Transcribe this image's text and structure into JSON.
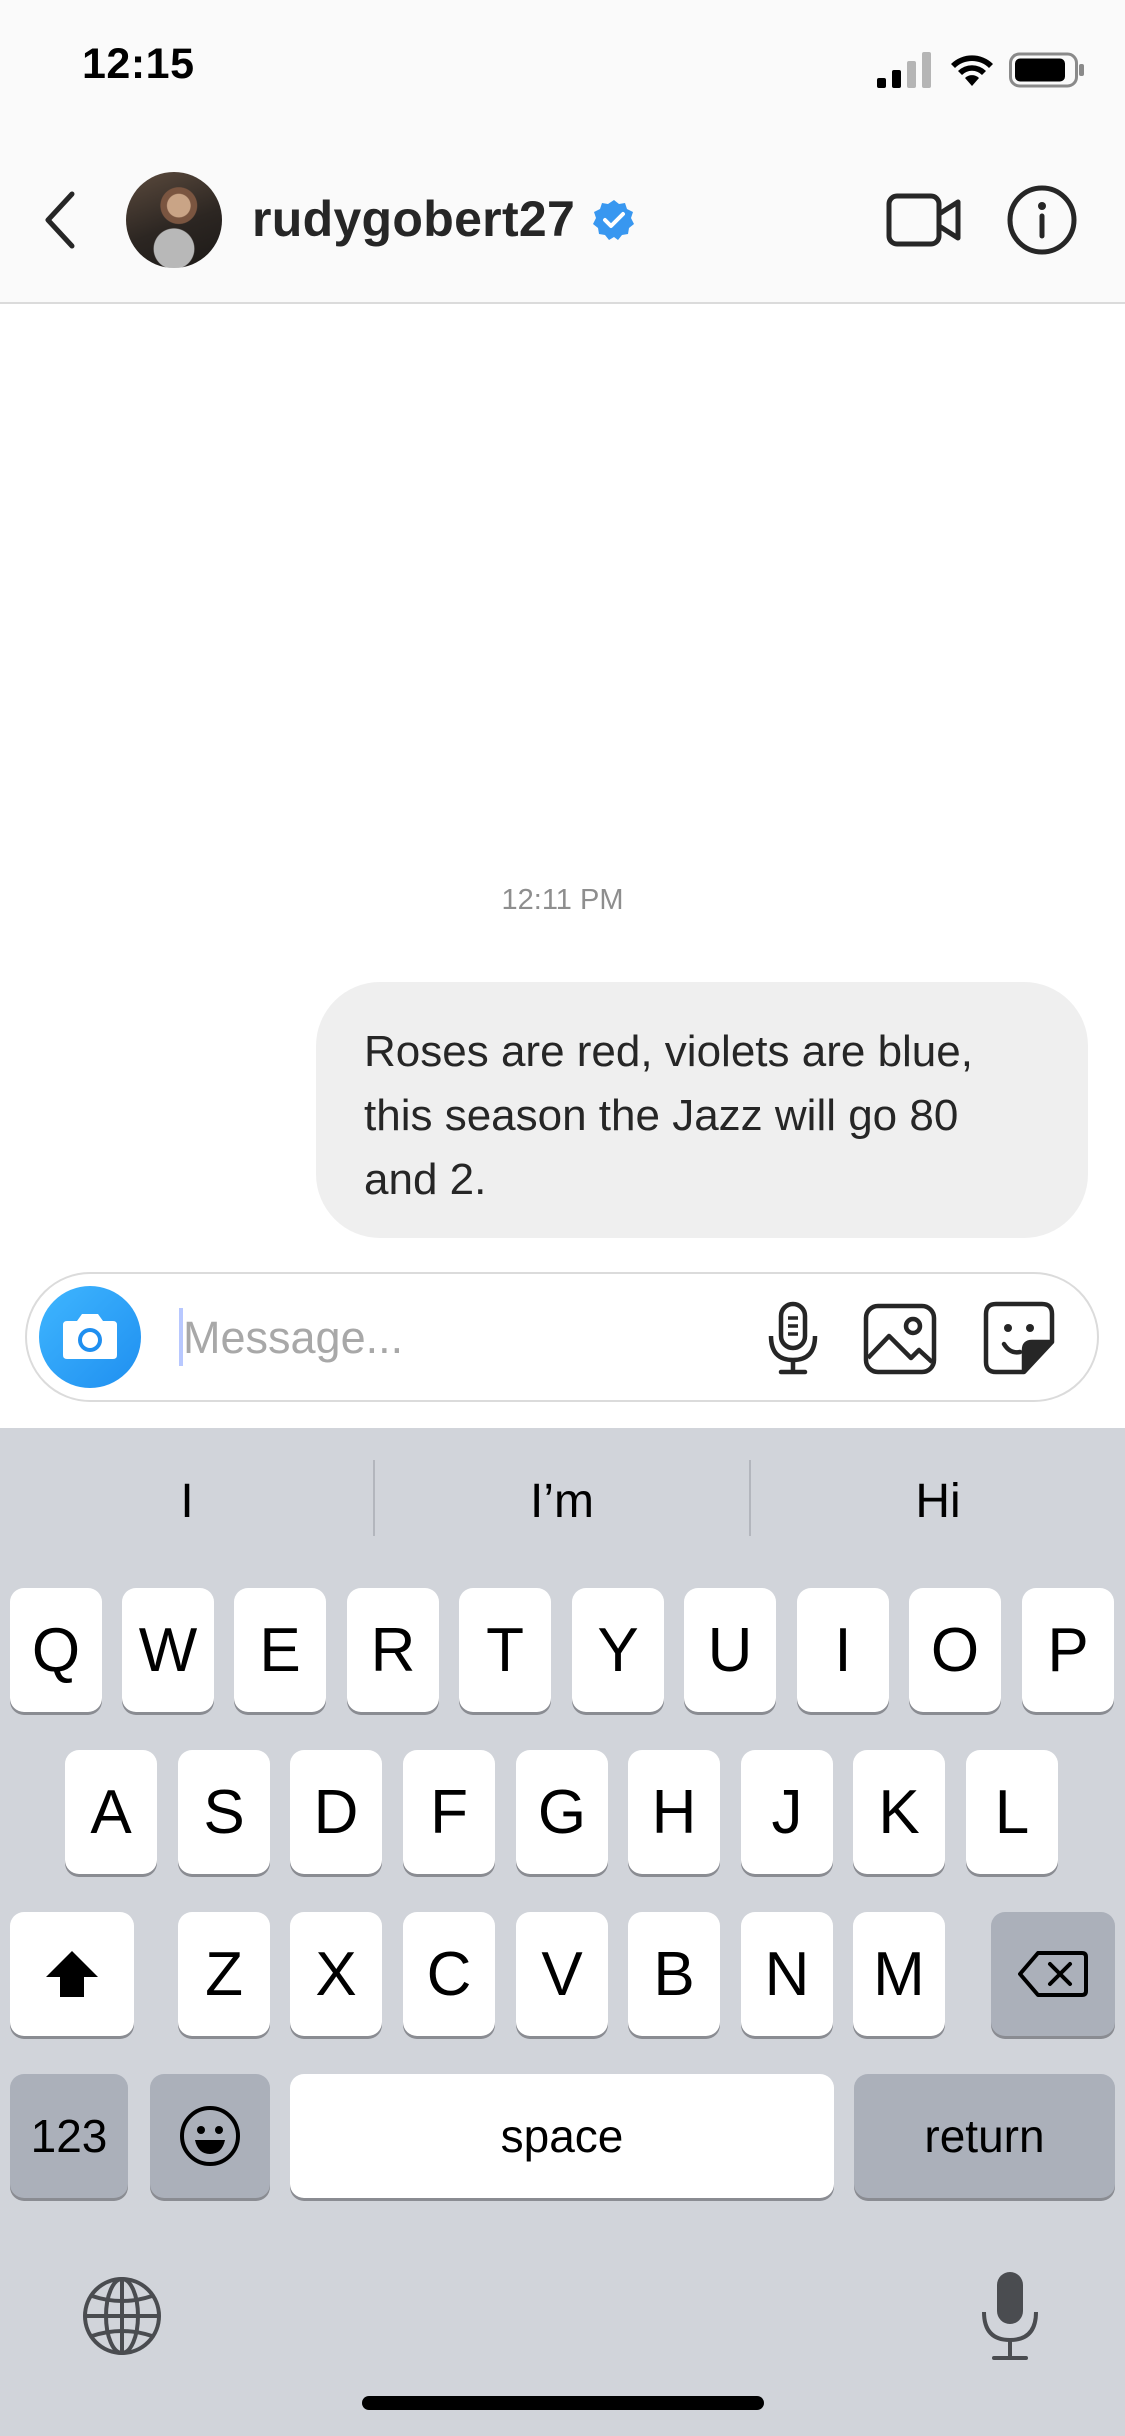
{
  "status_bar": {
    "time": "12:15",
    "icons": [
      "cellular-signal-icon",
      "wifi-icon",
      "battery-icon"
    ]
  },
  "header": {
    "back_icon": "chevron-left-icon",
    "username": "rudygobert27",
    "verified": true,
    "actions": [
      "video-call-icon",
      "info-icon"
    ]
  },
  "conversation": {
    "timestamp": "12:11 PM",
    "messages": [
      {
        "sender": "me",
        "text": "Roses are red, violets are blue, this season the Jazz will go 80 and 2.",
        "lines": [
          "Roses are red, violets are blue,",
          "this season the Jazz will go 80",
          "and 2."
        ]
      }
    ]
  },
  "composer": {
    "placeholder": "Message...",
    "icons": [
      "camera-icon",
      "microphone-icon",
      "gallery-icon",
      "sticker-icon"
    ]
  },
  "keyboard": {
    "suggestions": [
      "I",
      "I’m",
      "Hi"
    ],
    "row1": [
      "Q",
      "W",
      "E",
      "R",
      "T",
      "Y",
      "U",
      "I",
      "O",
      "P"
    ],
    "row2": [
      "A",
      "S",
      "D",
      "F",
      "G",
      "H",
      "J",
      "K",
      "L"
    ],
    "row3": [
      "Z",
      "X",
      "C",
      "V",
      "B",
      "N",
      "M"
    ],
    "numbers_label": "123",
    "space_label": "space",
    "return_label": "return"
  },
  "colors": {
    "accent": "#3897f0",
    "bubble": "#efefef",
    "keyboard_bg": "#d1d4da",
    "timestamp": "#8e8e8e"
  }
}
